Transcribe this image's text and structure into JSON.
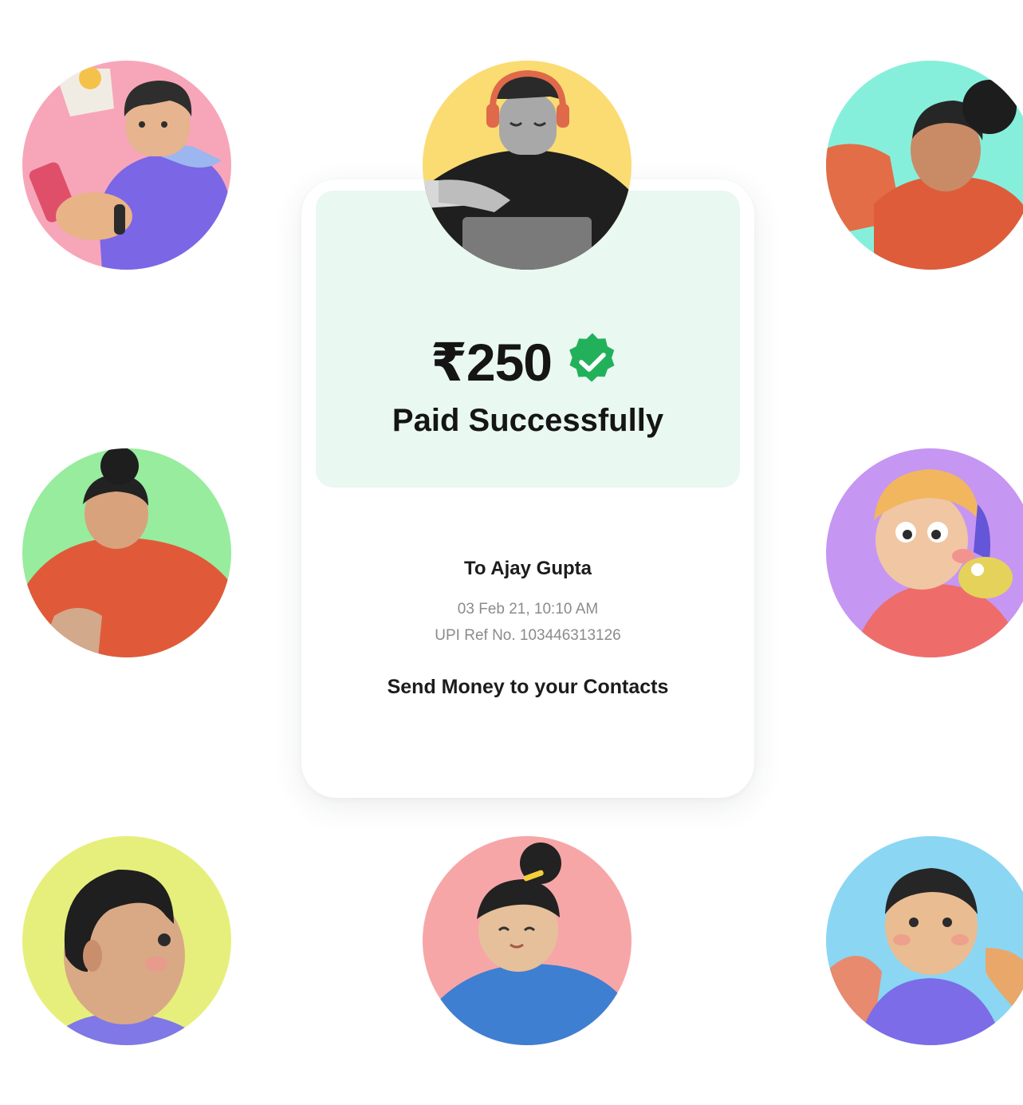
{
  "payment": {
    "amount": "₹250",
    "status": "Paid Successfully",
    "recipient": "To Ajay Gupta",
    "datetime": "03 Feb 21, 10:10 AM",
    "upi_ref": "UPI Ref No. 103446313126",
    "cta": "Send Money to your Contacts",
    "verified_icon": "verified-check-icon"
  },
  "colors": {
    "success_green": "#22b15a",
    "panel_bg": "#e9f8f1",
    "text_dark": "#151515",
    "text_muted": "#8b8b8b"
  },
  "avatars": [
    {
      "name": "avatar-pink-phone",
      "bg": "#f7a6b9"
    },
    {
      "name": "avatar-yellow-headphones",
      "bg": "#fbdc72"
    },
    {
      "name": "avatar-teal-bun",
      "bg": "#86efdc"
    },
    {
      "name": "avatar-green-bun",
      "bg": "#97ec9e"
    },
    {
      "name": "avatar-purple-cap",
      "bg": "#c696f3"
    },
    {
      "name": "avatar-lime-profile",
      "bg": "#e6ef7c"
    },
    {
      "name": "avatar-pink-topknot",
      "bg": "#f7a6a8"
    },
    {
      "name": "avatar-blue-smile",
      "bg": "#8bd6f3"
    }
  ]
}
